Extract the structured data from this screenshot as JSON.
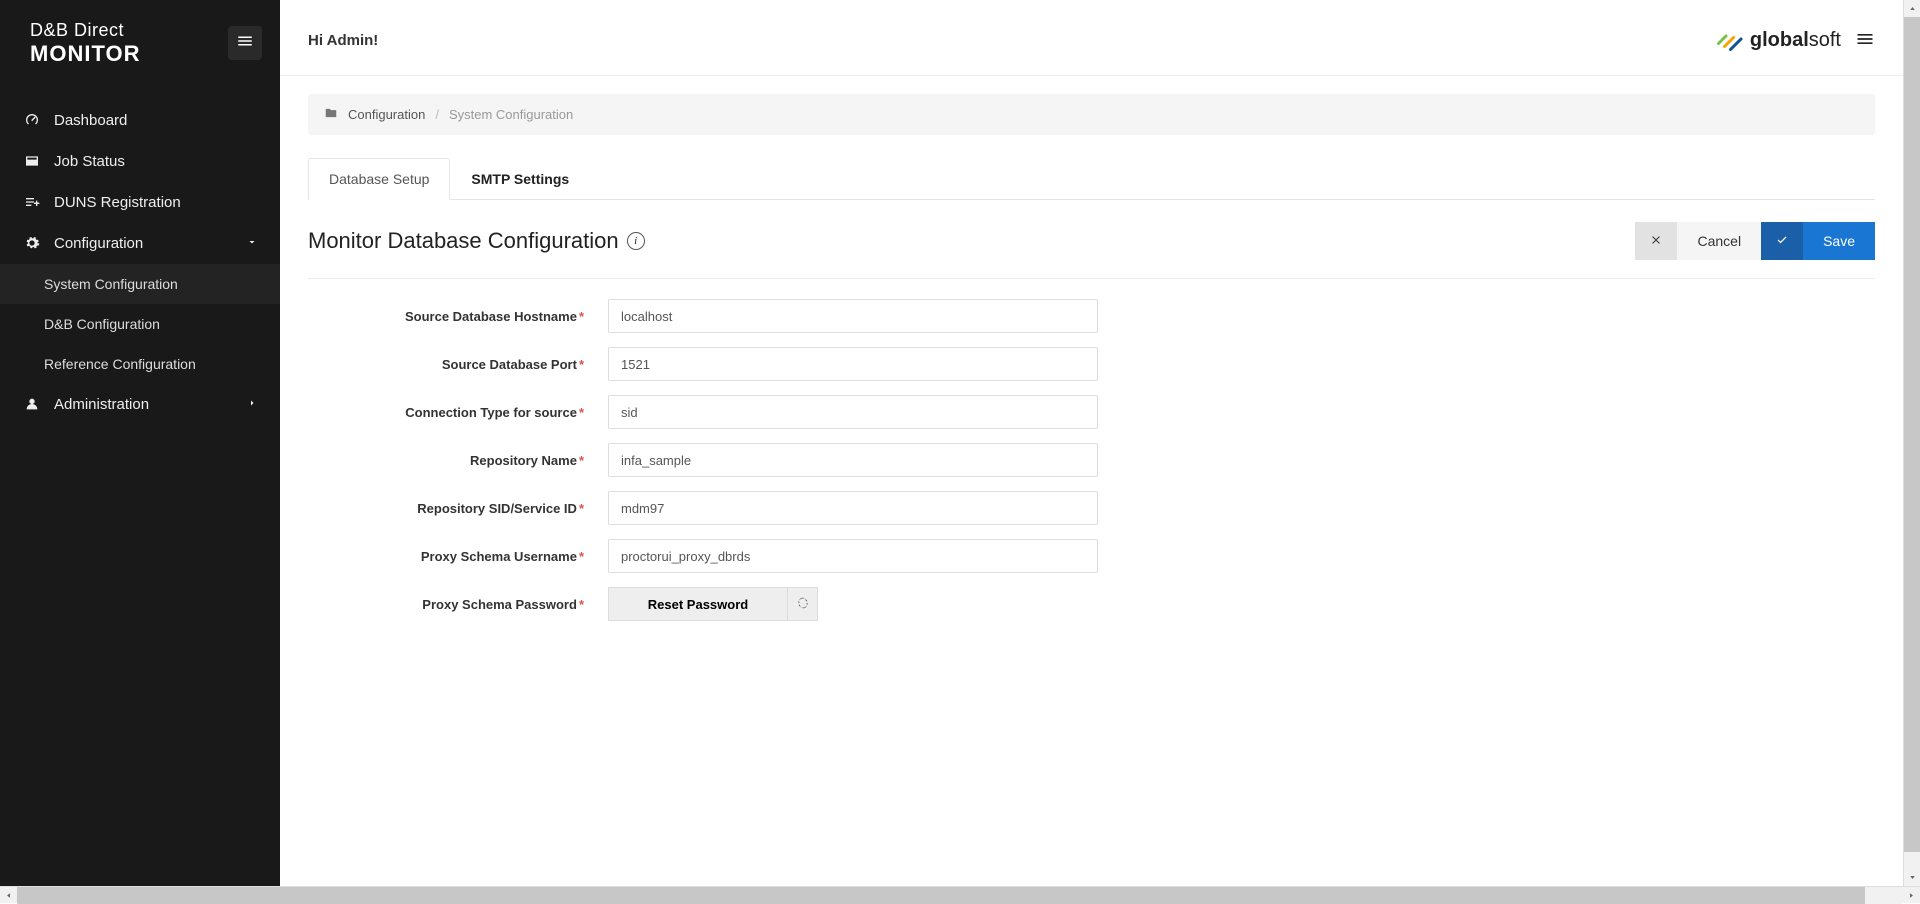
{
  "brand": {
    "line1": "D&B Direct",
    "line2": "MONITOR"
  },
  "sidebar": {
    "items": [
      {
        "label": "Dashboard"
      },
      {
        "label": "Job Status"
      },
      {
        "label": "DUNS Registration"
      },
      {
        "label": "Configuration"
      },
      {
        "label": "Administration"
      }
    ],
    "config_sub": [
      {
        "label": "System Configuration"
      },
      {
        "label": "D&B Configuration"
      },
      {
        "label": "Reference Configuration"
      }
    ]
  },
  "header": {
    "greeting": "Hi Admin!",
    "company_logo_text_bold": "global",
    "company_logo_text_light": "soft"
  },
  "breadcrumb": {
    "root": "Configuration",
    "current": "System Configuration"
  },
  "tabs": [
    {
      "label": "Database Setup",
      "active": true
    },
    {
      "label": "SMTP Settings",
      "active": false
    }
  ],
  "section": {
    "title": "Monitor Database Configuration"
  },
  "actions": {
    "cancel": "Cancel",
    "save": "Save"
  },
  "form": {
    "fields": [
      {
        "label": "Source Database Hostname",
        "value": "localhost",
        "required": true
      },
      {
        "label": "Source Database Port",
        "value": "1521",
        "required": true
      },
      {
        "label": "Connection Type for source",
        "value": "sid",
        "required": true
      },
      {
        "label": "Repository Name",
        "value": "infa_sample",
        "required": true
      },
      {
        "label": "Repository SID/Service ID",
        "value": "mdm97",
        "required": true
      },
      {
        "label": "Proxy Schema Username",
        "value": "proctorui_proxy_dbrds",
        "required": true
      }
    ],
    "password_label": "Proxy Schema Password",
    "reset_password": "Reset Password"
  }
}
